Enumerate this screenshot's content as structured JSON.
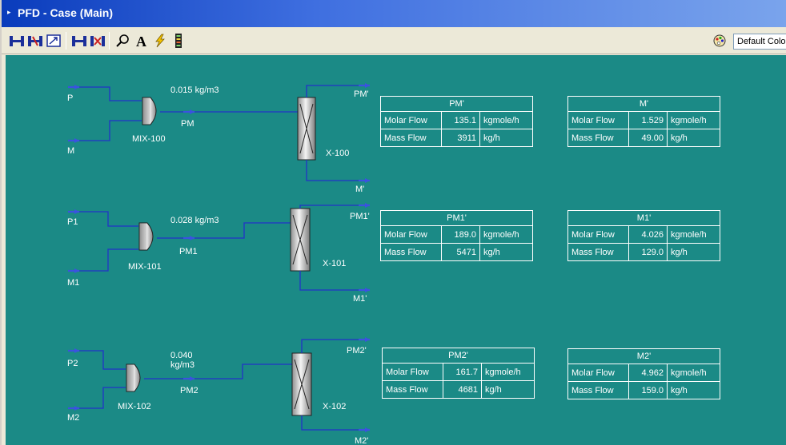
{
  "window": {
    "title": "PFD - Case (Main)"
  },
  "toolbar": {
    "color_scheme": "Default Colours",
    "buttons": [
      "size-mode-icon",
      "auto-position-icon",
      "zoom-fit-icon",
      "attach-mode-icon",
      "break-connection-icon",
      "find-icon",
      "text-label-icon",
      "lightning-icon",
      "workbook-icon"
    ]
  },
  "colors": {
    "canvas": "#1b8a86",
    "stream": "#2233c8",
    "label": "#ffffff"
  },
  "rows": [
    {
      "feed_a": "P",
      "feed_b": "M",
      "mixer": "MIX-100",
      "mixed": "PM",
      "density": "0.015 kg/m3",
      "separator": "X-100",
      "top_out": "PM'",
      "bottom_out": "M'",
      "table_top": {
        "title": "PM'",
        "molar_label": "Molar Flow",
        "molar_value": "135.1",
        "molar_unit": "kgmole/h",
        "mass_label": "Mass Flow",
        "mass_value": "3911",
        "mass_unit": "kg/h"
      },
      "table_bottom": {
        "title": "M'",
        "molar_label": "Molar Flow",
        "molar_value": "1.529",
        "molar_unit": "kgmole/h",
        "mass_label": "Mass Flow",
        "mass_value": "49.00",
        "mass_unit": "kg/h"
      }
    },
    {
      "feed_a": "P1",
      "feed_b": "M1",
      "mixer": "MIX-101",
      "mixed": "PM1",
      "density": "0.028 kg/m3",
      "separator": "X-101",
      "top_out": "PM1'",
      "bottom_out": "M1'",
      "table_top": {
        "title": "PM1'",
        "molar_label": "Molar Flow",
        "molar_value": "189.0",
        "molar_unit": "kgmole/h",
        "mass_label": "Mass Flow",
        "mass_value": "5471",
        "mass_unit": "kg/h"
      },
      "table_bottom": {
        "title": "M1'",
        "molar_label": "Molar Flow",
        "molar_value": "4.026",
        "molar_unit": "kgmole/h",
        "mass_label": "Mass Flow",
        "mass_value": "129.0",
        "mass_unit": "kg/h"
      }
    },
    {
      "feed_a": "P2",
      "feed_b": "M2",
      "mixer": "MIX-102",
      "mixed": "PM2",
      "density_line1": "0.040",
      "density_line2": "kg/m3",
      "separator": "X-102",
      "top_out": "PM2'",
      "bottom_out": "M2'",
      "table_top": {
        "title": "PM2'",
        "molar_label": "Molar Flow",
        "molar_value": "161.7",
        "molar_unit": "kgmole/h",
        "mass_label": "Mass Flow",
        "mass_value": "4681",
        "mass_unit": "kg/h"
      },
      "table_bottom": {
        "title": "M2'",
        "molar_label": "Molar Flow",
        "molar_value": "4.962",
        "molar_unit": "kgmole/h",
        "mass_label": "Mass Flow",
        "mass_value": "159.0",
        "mass_unit": "kg/h"
      }
    }
  ]
}
